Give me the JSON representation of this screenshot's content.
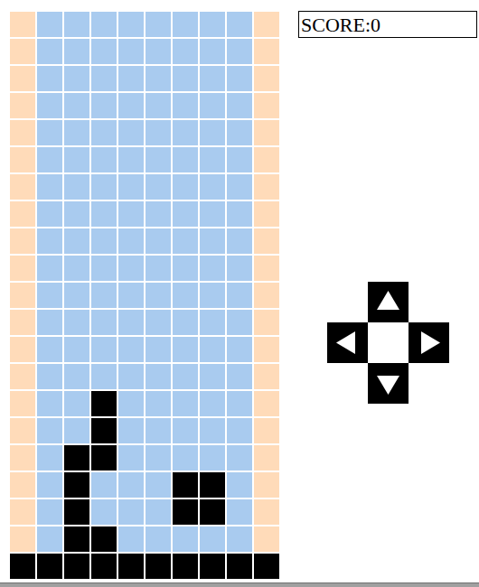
{
  "score": {
    "label": "SCORE:0"
  },
  "board": {
    "rows": [
      [
        "wall",
        "empty",
        "empty",
        "empty",
        "empty",
        "empty",
        "empty",
        "empty",
        "empty",
        "wall"
      ],
      [
        "wall",
        "empty",
        "empty",
        "empty",
        "empty",
        "empty",
        "empty",
        "empty",
        "empty",
        "wall"
      ],
      [
        "wall",
        "empty",
        "empty",
        "empty",
        "empty",
        "empty",
        "empty",
        "empty",
        "empty",
        "wall"
      ],
      [
        "wall",
        "empty",
        "empty",
        "empty",
        "empty",
        "empty",
        "empty",
        "empty",
        "empty",
        "wall"
      ],
      [
        "wall",
        "empty",
        "empty",
        "empty",
        "empty",
        "empty",
        "empty",
        "empty",
        "empty",
        "wall"
      ],
      [
        "wall",
        "empty",
        "empty",
        "empty",
        "empty",
        "empty",
        "empty",
        "empty",
        "empty",
        "wall"
      ],
      [
        "wall",
        "empty",
        "empty",
        "empty",
        "empty",
        "empty",
        "empty",
        "empty",
        "empty",
        "wall"
      ],
      [
        "wall",
        "empty",
        "empty",
        "empty",
        "empty",
        "empty",
        "empty",
        "empty",
        "empty",
        "wall"
      ],
      [
        "wall",
        "empty",
        "empty",
        "empty",
        "empty",
        "empty",
        "empty",
        "empty",
        "empty",
        "wall"
      ],
      [
        "wall",
        "empty",
        "empty",
        "empty",
        "empty",
        "empty",
        "empty",
        "empty",
        "empty",
        "wall"
      ],
      [
        "wall",
        "empty",
        "empty",
        "empty",
        "empty",
        "empty",
        "empty",
        "empty",
        "empty",
        "wall"
      ],
      [
        "wall",
        "empty",
        "empty",
        "empty",
        "empty",
        "empty",
        "empty",
        "empty",
        "empty",
        "wall"
      ],
      [
        "wall",
        "empty",
        "empty",
        "empty",
        "empty",
        "empty",
        "empty",
        "empty",
        "empty",
        "wall"
      ],
      [
        "wall",
        "empty",
        "empty",
        "empty",
        "empty",
        "empty",
        "empty",
        "empty",
        "empty",
        "wall"
      ],
      [
        "wall",
        "empty",
        "empty",
        "block",
        "empty",
        "empty",
        "empty",
        "empty",
        "empty",
        "wall"
      ],
      [
        "wall",
        "empty",
        "empty",
        "block",
        "empty",
        "empty",
        "empty",
        "empty",
        "empty",
        "wall"
      ],
      [
        "wall",
        "empty",
        "block",
        "block",
        "empty",
        "empty",
        "empty",
        "empty",
        "empty",
        "wall"
      ],
      [
        "wall",
        "empty",
        "block",
        "empty",
        "empty",
        "empty",
        "block",
        "block",
        "empty",
        "wall"
      ],
      [
        "wall",
        "empty",
        "block",
        "empty",
        "empty",
        "empty",
        "block",
        "block",
        "empty",
        "wall"
      ],
      [
        "wall",
        "empty",
        "block",
        "block",
        "empty",
        "empty",
        "empty",
        "empty",
        "empty",
        "wall"
      ],
      [
        "block",
        "block",
        "block",
        "block",
        "block",
        "block",
        "block",
        "block",
        "block",
        "block"
      ]
    ]
  }
}
